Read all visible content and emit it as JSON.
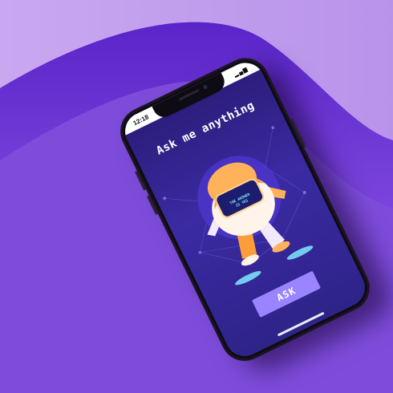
{
  "status_bar": {
    "time": "12:18"
  },
  "app": {
    "title": "Ask me anything",
    "answer_display": "THE ANSWER\nIS YES",
    "ask_button_label": "ASK"
  },
  "colors": {
    "background": "#7a43d6",
    "screen_bg": "#2e2388",
    "button": "#9a84ff",
    "robot_orange": "#ff9d3a",
    "robot_visor": "#1e1c6e"
  }
}
